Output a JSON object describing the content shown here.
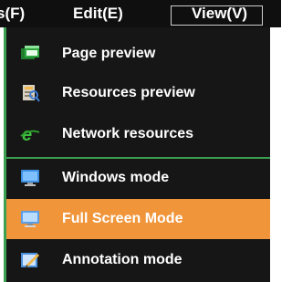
{
  "menubar": {
    "file_label": "s(F)",
    "edit_label": "Edit(E)",
    "view_label": "View(V)"
  },
  "view_menu": {
    "items": [
      {
        "label": "Page preview",
        "icon": "page-preview-icon"
      },
      {
        "label": "Resources preview",
        "icon": "resources-preview-icon"
      },
      {
        "label": "Network resources",
        "icon": "network-resources-icon"
      },
      {
        "label": "Windows mode",
        "icon": "windows-mode-icon"
      },
      {
        "label": "Full Screen Mode",
        "icon": "full-screen-mode-icon"
      },
      {
        "label": "Annotation mode",
        "icon": "annotation-mode-icon"
      }
    ],
    "highlight_color": "#f0953a",
    "separator_color": "#3ba050"
  }
}
